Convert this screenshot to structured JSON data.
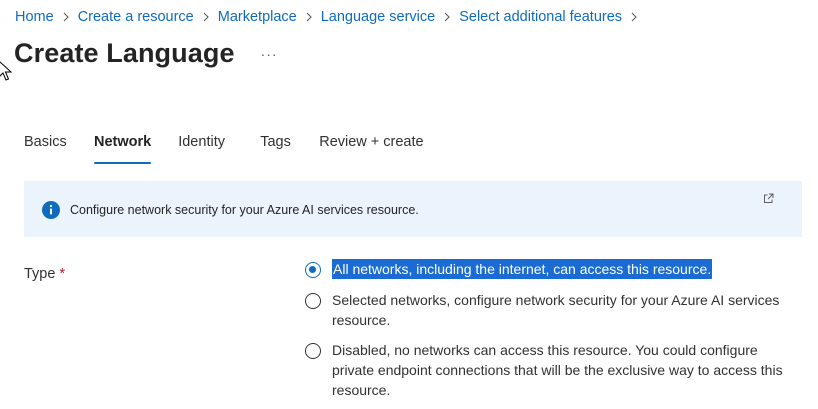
{
  "breadcrumb": [
    {
      "label": "Home"
    },
    {
      "label": "Create a resource"
    },
    {
      "label": "Marketplace"
    },
    {
      "label": "Language service"
    },
    {
      "label": "Select additional features"
    }
  ],
  "page": {
    "title": "Create Language",
    "more_label": "···"
  },
  "tabs": [
    {
      "label": "Basics",
      "active": false
    },
    {
      "label": "Network",
      "active": true
    },
    {
      "label": "Identity",
      "active": false
    },
    {
      "label": "Tags",
      "active": false
    },
    {
      "label": "Review + create",
      "active": false
    }
  ],
  "info": {
    "text": "Configure network security for your Azure AI services resource.",
    "icon": "info-icon",
    "link_icon": "external-link-icon"
  },
  "network_type": {
    "label": "Type",
    "required_marker": "*",
    "options": [
      {
        "text": "All networks, including the internet, can access this resource.",
        "checked": true
      },
      {
        "text": "Selected networks, configure network security for your Azure AI services resource.",
        "checked": false
      },
      {
        "text": "Disabled, no networks can access this resource. You could configure private endpoint connections that will be the exclusive way to access this resource.",
        "checked": false
      }
    ]
  },
  "colors": {
    "accent": "#0f6cbd",
    "info_background": "#ebf3fc",
    "selection_highlight": "#1a6bd4",
    "required": "#a4262c"
  }
}
